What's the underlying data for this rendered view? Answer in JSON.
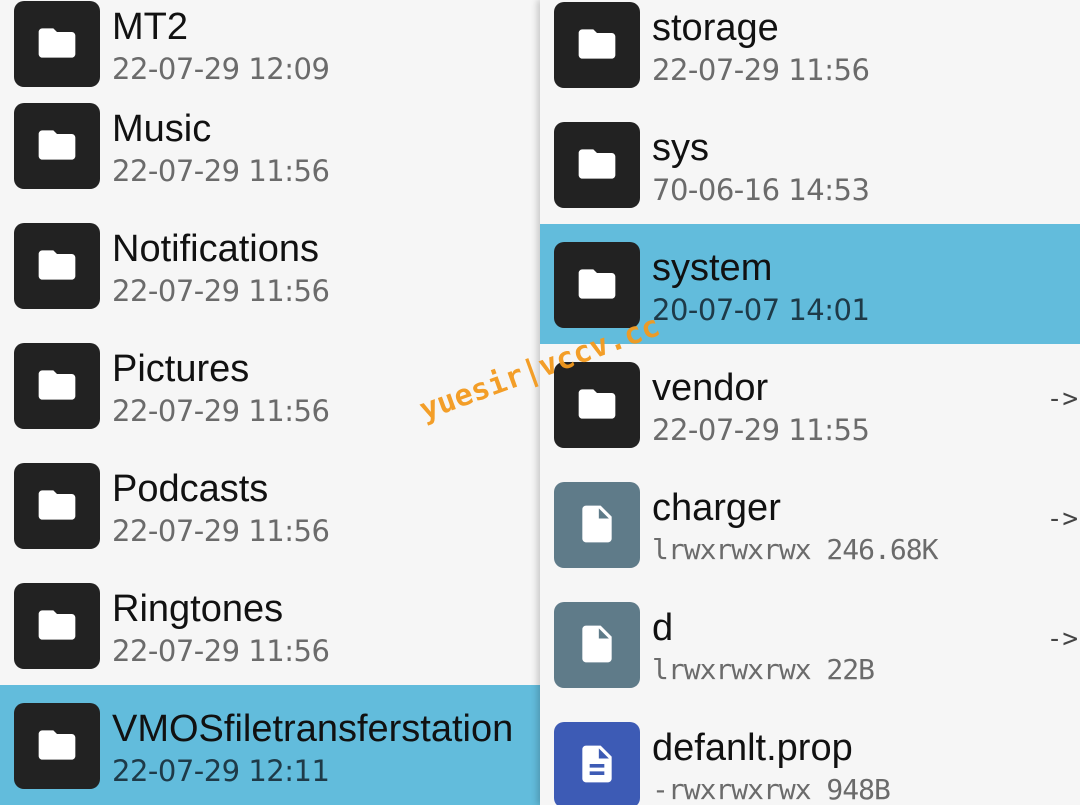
{
  "left_pane": {
    "items": [
      {
        "name": "MT2",
        "date": "22-07-29 12:09"
      },
      {
        "name": "Music",
        "date": "22-07-29 11:56"
      },
      {
        "name": "Notifications",
        "date": "22-07-29 11:56"
      },
      {
        "name": "Pictures",
        "date": "22-07-29 11:56"
      },
      {
        "name": "Podcasts",
        "date": "22-07-29 11:56"
      },
      {
        "name": "Ringtones",
        "date": "22-07-29 11:56"
      },
      {
        "name": "VMOSfiletransferstation",
        "date": "22-07-29 12:11"
      }
    ],
    "selected_index": 6
  },
  "right_pane": {
    "items": [
      {
        "name": "storage",
        "meta": "22-07-29 11:56",
        "kind": "folder-icon"
      },
      {
        "name": "sys",
        "meta": "70-06-16 14:53",
        "kind": "folder-icon"
      },
      {
        "name": "system",
        "meta": "20-07-07 14:01",
        "kind": "folder-icon"
      },
      {
        "name": "vendor",
        "meta": "22-07-29 11:55",
        "kind": "folder-icon",
        "arrow": "->"
      },
      {
        "name": "charger",
        "meta": "lrwxrwxrwx 246.68K",
        "kind": "file-icon",
        "arrow": "->"
      },
      {
        "name": "d",
        "meta": "lrwxrwxrwx 22B",
        "kind": "file-icon",
        "arrow": "->"
      },
      {
        "name": "defanlt.prop",
        "meta": "-rwxrwxrwx 948B",
        "kind": "text-file-icon"
      }
    ],
    "selected_index": 2
  },
  "watermark": "yuesir|vccv.cc",
  "colors": {
    "background": "#f6f6f6",
    "selected": "#62bcdc",
    "folder_icon_bg": "#222222",
    "file_icon_bg": "#5f7b89",
    "text_file_icon_bg": "#3d5bb5",
    "watermark": "#f39a1e"
  }
}
